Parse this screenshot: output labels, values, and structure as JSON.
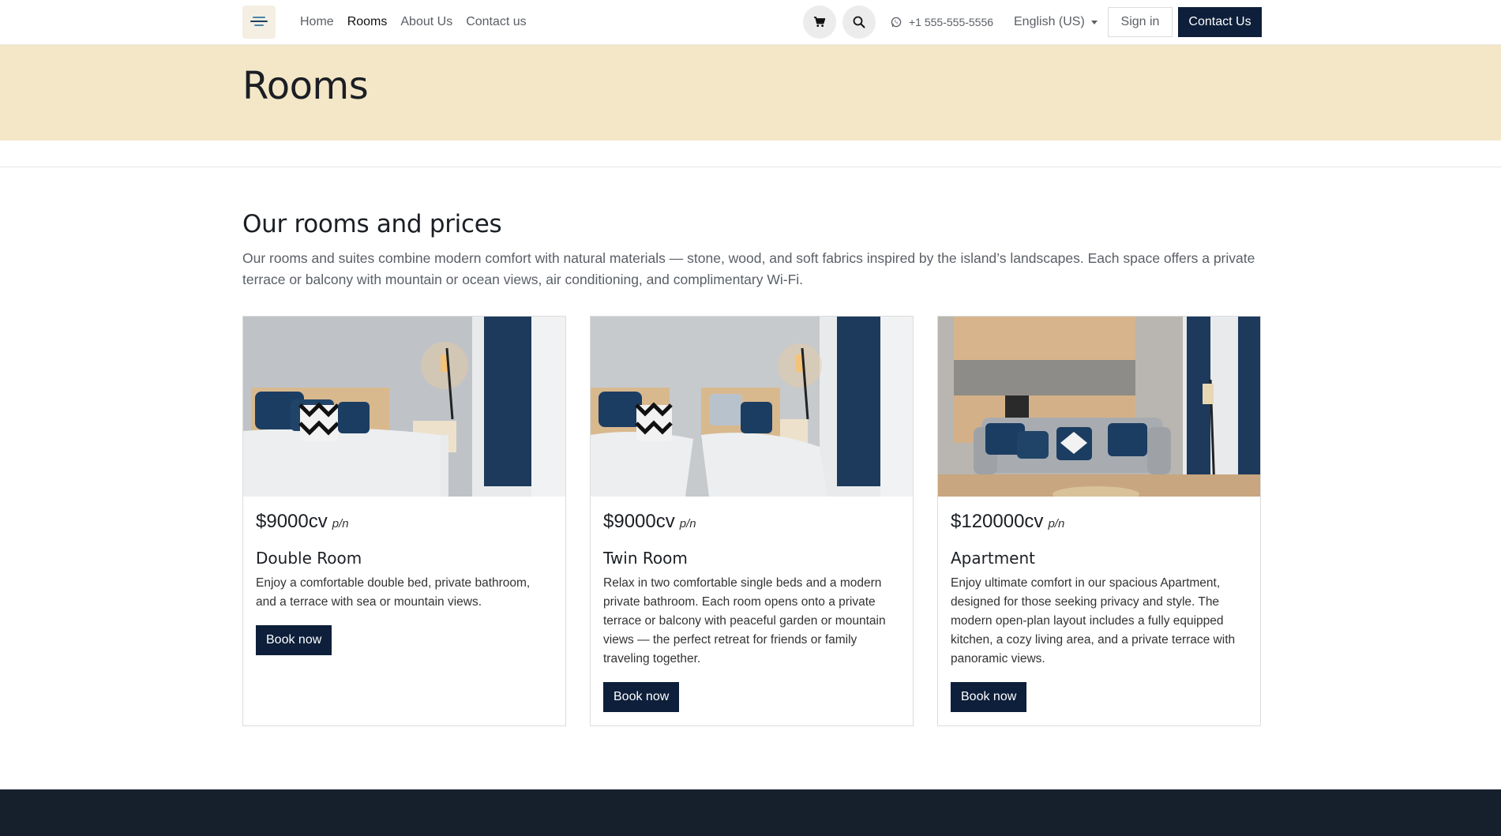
{
  "header": {
    "nav": [
      {
        "label": "Home"
      },
      {
        "label": "Rooms"
      },
      {
        "label": "About Us"
      },
      {
        "label": "Contact us"
      }
    ],
    "phone": "+1 555-555-5556",
    "language": "English (US)",
    "signin_label": "Sign in",
    "contact_label": "Contact Us",
    "icons": [
      "cart-icon",
      "search-icon",
      "whatsapp-icon",
      "chevron-down-icon"
    ]
  },
  "hero": {
    "title": "Rooms"
  },
  "section": {
    "title": "Our rooms and prices",
    "description": "Our rooms and suites combine modern comfort with natural materials — stone, wood, and soft fabrics inspired by the island’s landscapes. Each space offers a private terrace or balcony with mountain or ocean views, air conditioning, and complimentary Wi-Fi."
  },
  "rooms": [
    {
      "price": "$9000cv",
      "per": "p/n",
      "name": "Double Room",
      "description": "Enjoy a comfortable double bed, private bathroom, and a terrace with sea or mountain views.",
      "button": "Book now"
    },
    {
      "price": "$9000cv",
      "per": "p/n",
      "name": "Twin Room",
      "description": "Relax in two comfortable single beds and a modern private bathroom. Each room opens onto a private terrace or balcony with peaceful garden or mountain views — the perfect retreat for friends or family traveling together.",
      "button": "Book now"
    },
    {
      "price": "$120000cv",
      "per": "p/n",
      "name": "Apartment",
      "description": "Enjoy ultimate comfort in our spacious Apartment, designed for those seeking privacy and style. The modern open-plan layout includes a fully equipped kitchen, a cozy living area, and a private terrace with panoramic views.",
      "button": "Book now"
    }
  ],
  "colors": {
    "accent": "#0d1f3a",
    "hero_bg": "#f4e7c7",
    "footer_bg": "#16202d"
  }
}
